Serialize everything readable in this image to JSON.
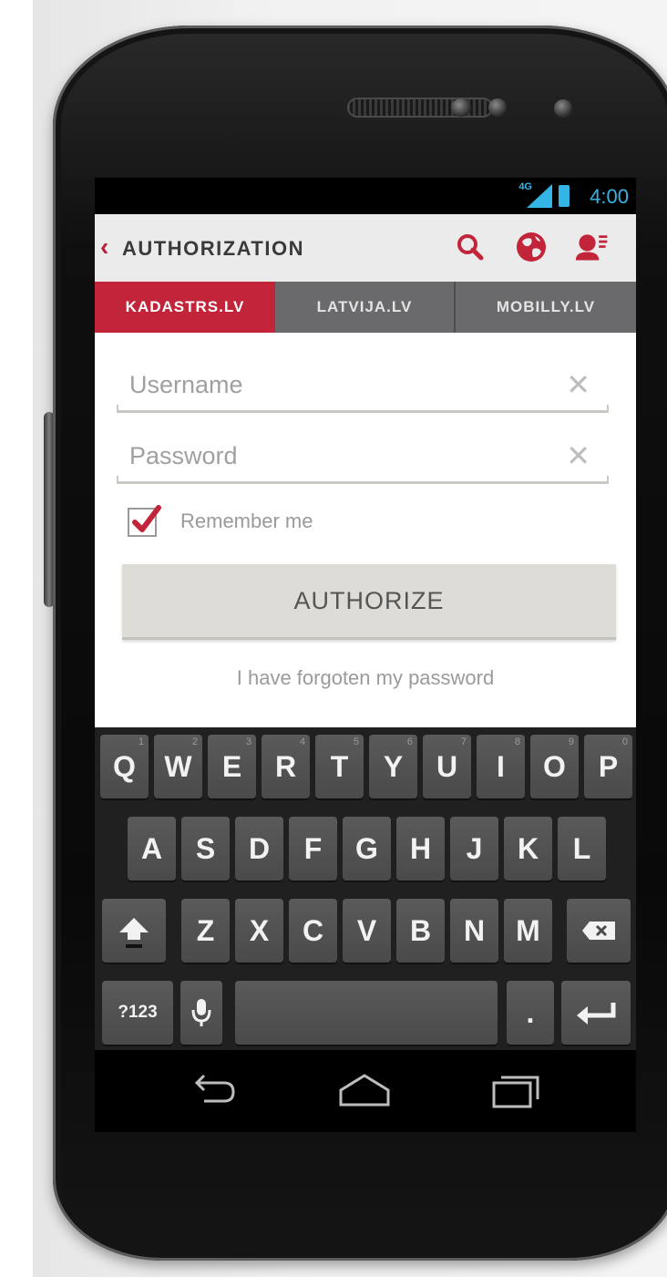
{
  "status": {
    "network": "4G",
    "time": "4:00"
  },
  "header": {
    "back_glyph": "‹",
    "title": "AUTHORIZATION",
    "icons": [
      "search-icon",
      "globe-icon",
      "user-menu-icon"
    ]
  },
  "tabs": [
    {
      "label": "KADASTRS.LV",
      "active": true
    },
    {
      "label": "LATVIJA.LV",
      "active": false
    },
    {
      "label": "MOBILLY.LV",
      "active": false
    }
  ],
  "form": {
    "username_placeholder": "Username",
    "password_placeholder": "Password",
    "clear_glyph": "✕",
    "remember_label": "Remember me",
    "remember_checked": true,
    "authorize_label": "AUTHORIZE",
    "forgot_link": "I have forgoten my password"
  },
  "keyboard": {
    "row1": [
      {
        "k": "Q",
        "h": "1"
      },
      {
        "k": "W",
        "h": "2"
      },
      {
        "k": "E",
        "h": "3"
      },
      {
        "k": "R",
        "h": "4"
      },
      {
        "k": "T",
        "h": "5"
      },
      {
        "k": "Y",
        "h": "6"
      },
      {
        "k": "U",
        "h": "7"
      },
      {
        "k": "I",
        "h": "8"
      },
      {
        "k": "O",
        "h": "9"
      },
      {
        "k": "P",
        "h": "0"
      }
    ],
    "row2": [
      "A",
      "S",
      "D",
      "F",
      "G",
      "H",
      "J",
      "K",
      "L"
    ],
    "row3": [
      "Z",
      "X",
      "C",
      "V",
      "B",
      "N",
      "M"
    ],
    "symbols_label": "?123",
    "period_label": "."
  },
  "colors": {
    "accent": "#c2253a",
    "status_blue": "#33b5e5",
    "header_bg": "#ebebeb",
    "tab_bg": "#6a6a6c"
  }
}
